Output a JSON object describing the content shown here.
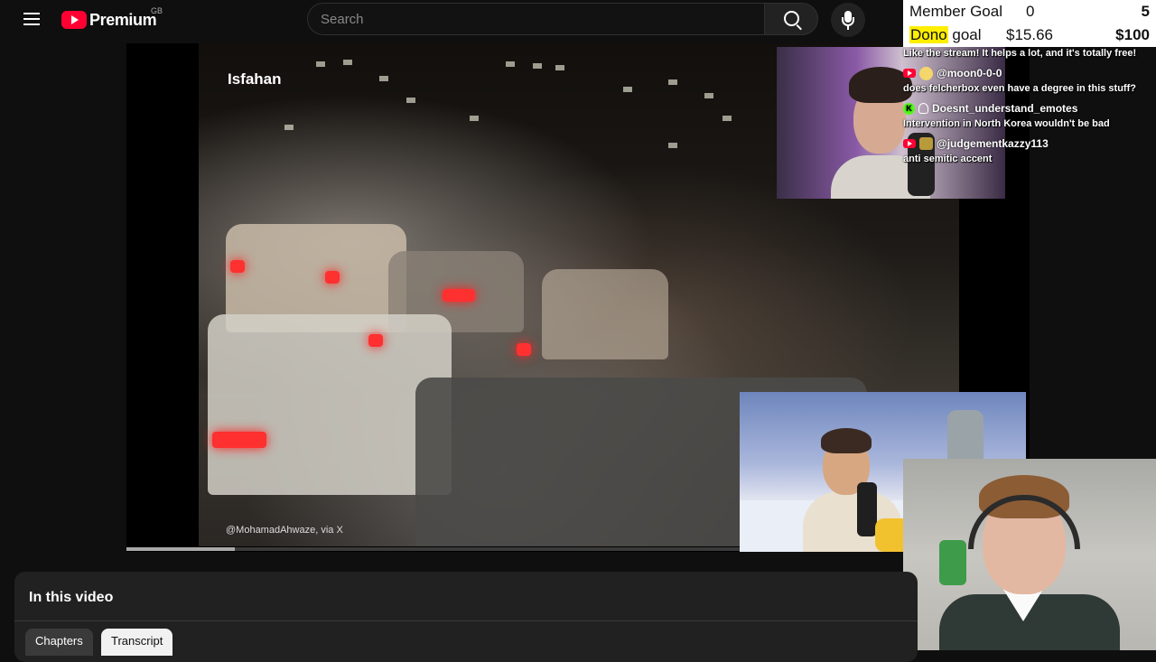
{
  "topbar": {
    "logo_text": "Premium",
    "logo_region": "GB",
    "search_placeholder": "Search"
  },
  "video": {
    "caption_location": "Isfahan",
    "caption_credit": "@MohamadAhwaze, via X",
    "progress_fraction": 0.12
  },
  "overlay": {
    "member_goal": {
      "label": "Member Goal",
      "current": "0",
      "target": "5"
    },
    "dono_goal": {
      "label_highlight": "Dono",
      "label_rest": " goal",
      "current": "$15.66",
      "target": "$100"
    },
    "chat_intro": "Like the stream! It helps a lot, and it's totally free!",
    "messages": [
      {
        "platform": "youtube",
        "badge": "emoji",
        "user": "@moon0-0-0",
        "text": "does felcherbox even have a degree in this stuff?"
      },
      {
        "platform": "kick",
        "badge": "user",
        "user": "Doesnt_understand_emotes",
        "text": "Intervention in North Korea wouldn't be bad"
      },
      {
        "platform": "youtube",
        "badge": "emote",
        "user": "@judgementkazzy113",
        "text": "anti semitic accent"
      }
    ]
  },
  "panel": {
    "title": "In this video",
    "tabs": [
      "Chapters",
      "Transcript"
    ],
    "selected_tab": "Transcript"
  }
}
